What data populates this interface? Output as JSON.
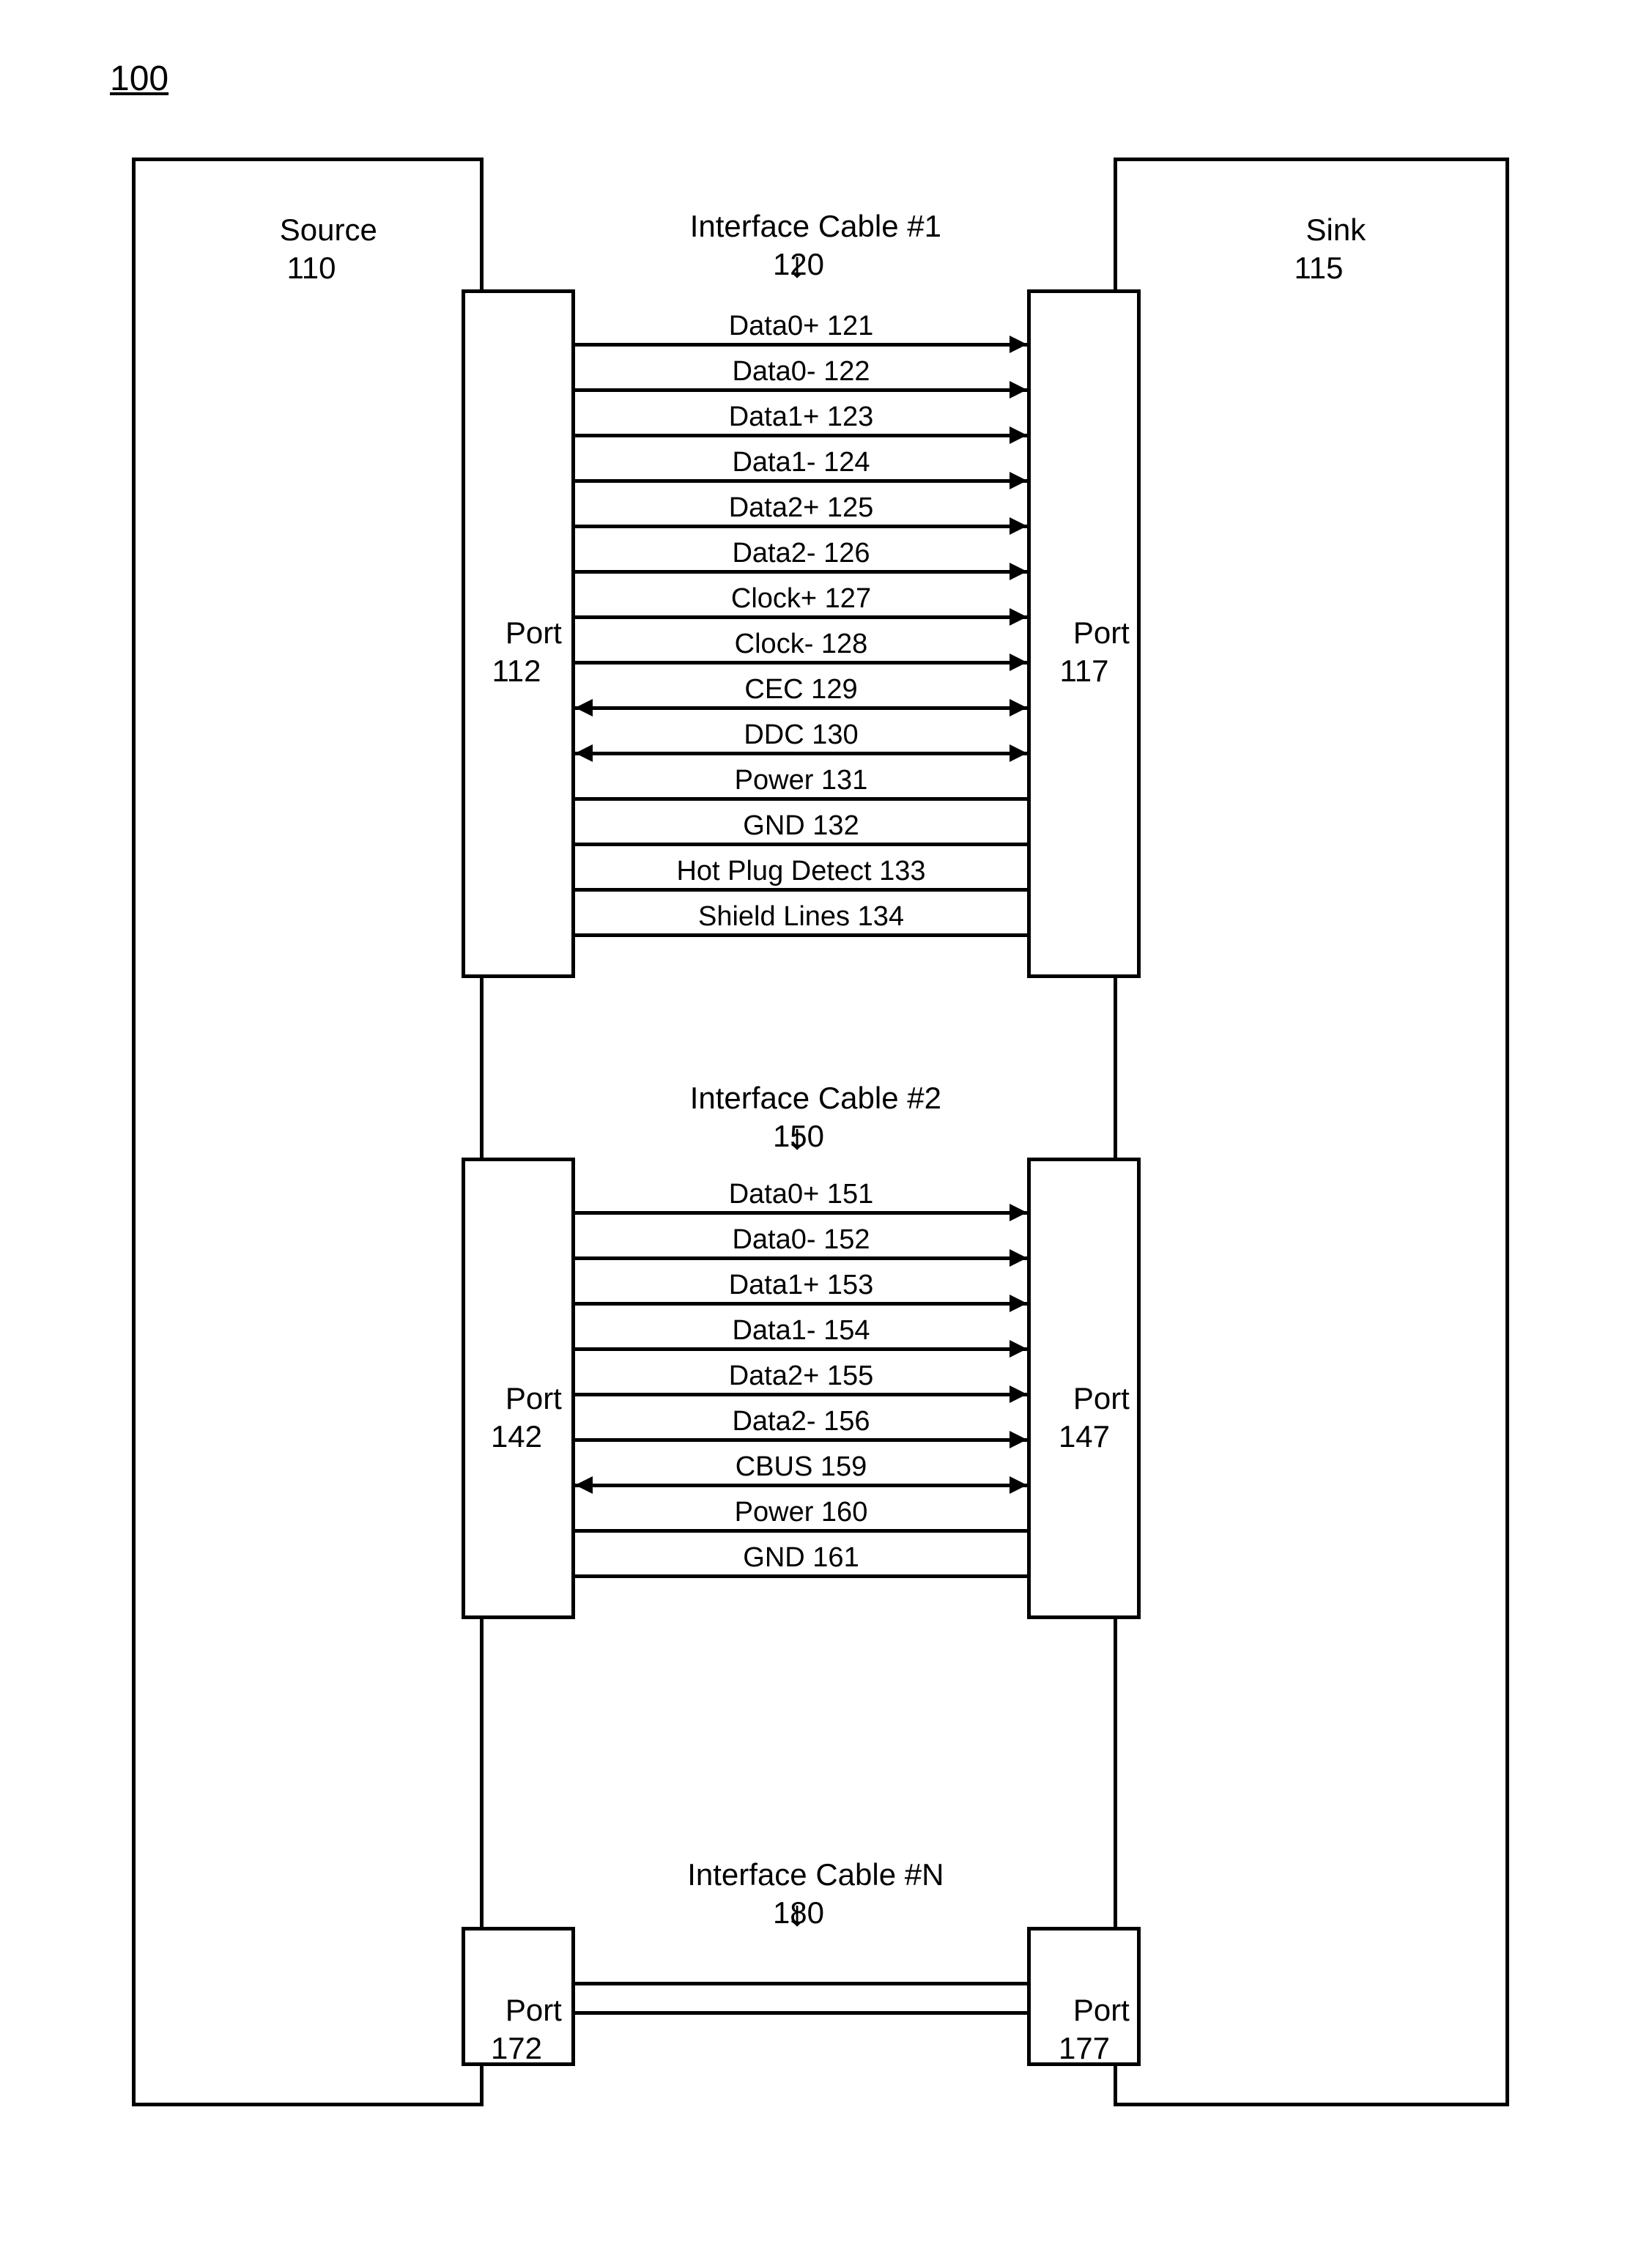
{
  "figure_number": "100",
  "source": {
    "title": "Source",
    "ref": "110"
  },
  "sink": {
    "title": "Sink",
    "ref": "115"
  },
  "cable1": {
    "title": "Interface Cable #1",
    "ref": "120",
    "port_left": {
      "title": "Port",
      "ref": "112"
    },
    "port_right": {
      "title": "Port",
      "ref": "117"
    },
    "signals": [
      {
        "label": "Data0+ 121",
        "dir": "right"
      },
      {
        "label": "Data0- 122",
        "dir": "right"
      },
      {
        "label": "Data1+ 123",
        "dir": "right"
      },
      {
        "label": "Data1- 124",
        "dir": "right"
      },
      {
        "label": "Data2+ 125",
        "dir": "right"
      },
      {
        "label": "Data2- 126",
        "dir": "right"
      },
      {
        "label": "Clock+ 127",
        "dir": "right"
      },
      {
        "label": "Clock- 128",
        "dir": "right"
      },
      {
        "label": "CEC 129",
        "dir": "both"
      },
      {
        "label": "DDC 130",
        "dir": "both"
      },
      {
        "label": "Power 131",
        "dir": "none"
      },
      {
        "label": "GND 132",
        "dir": "none"
      },
      {
        "label": "Hot Plug Detect 133",
        "dir": "none"
      },
      {
        "label": "Shield Lines 134",
        "dir": "none"
      }
    ]
  },
  "cable2": {
    "title": "Interface Cable #2",
    "ref": "150",
    "port_left": {
      "title": "Port",
      "ref": "142"
    },
    "port_right": {
      "title": "Port",
      "ref": "147"
    },
    "signals": [
      {
        "label": "Data0+ 151",
        "dir": "right"
      },
      {
        "label": "Data0- 152",
        "dir": "right"
      },
      {
        "label": "Data1+ 153",
        "dir": "right"
      },
      {
        "label": "Data1- 154",
        "dir": "right"
      },
      {
        "label": "Data2+ 155",
        "dir": "right"
      },
      {
        "label": "Data2- 156",
        "dir": "right"
      },
      {
        "label": "CBUS 159",
        "dir": "both"
      },
      {
        "label": "Power 160",
        "dir": "none"
      },
      {
        "label": "GND 161",
        "dir": "none"
      }
    ]
  },
  "cableN": {
    "title": "Interface Cable #N",
    "ref": "180",
    "port_left": {
      "title": "Port",
      "ref": "172"
    },
    "port_right": {
      "title": "Port",
      "ref": "177"
    }
  }
}
